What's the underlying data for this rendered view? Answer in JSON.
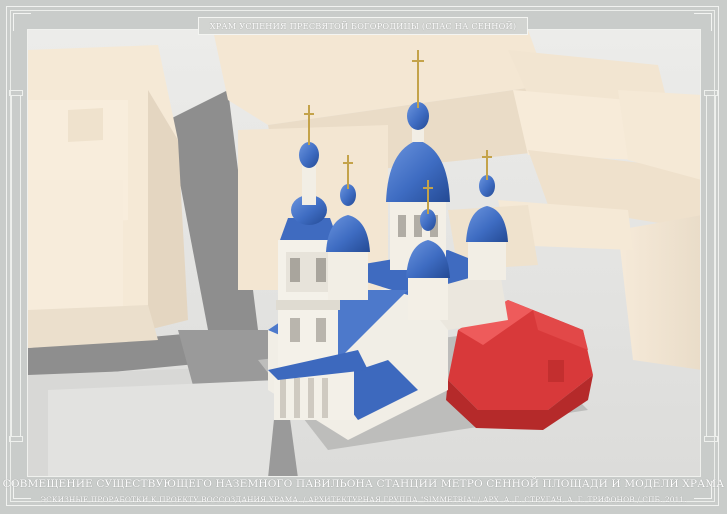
{
  "sheet": {
    "title": "ХРАМ УСПЕНИЯ ПРЕСВЯТОЙ БОГОРОДИЦЫ (СПАС НА СЕННОЙ)",
    "caption_main": "СОВМЕЩЕНИЕ СУЩЕСТВУЮЩЕГО НАЗЕМНОГО ПАВИЛЬОНА СТАНЦИИ МЕТРО СЕННОЙ ПЛОЩАДИ И МОДЕЛИ ХРАМА",
    "caption_sub": "ЭСКИЗНЫЕ ПРОРАБОТКИ К ПРОЕКТУ ВОССОЗДАНИЯ ХРАМА. / АРХИТЕКТУРНАЯ ГРУППА \"SIMMETRIA\" / АРХ. А. Г. СТРУГАЧ, А. Г. ТРИФОНОВ / СПБ. 2011."
  },
  "colors": {
    "background": "#c9ccca",
    "frame_lines": "#f1f2f0",
    "dome_blue": "#3f6fc4",
    "church_walls": "#f2efe6",
    "buildings": "#f3e6d2",
    "pavilion_red": "#d63a3a",
    "ground": "#e3e3e1",
    "roads": "#8f8f8f"
  }
}
